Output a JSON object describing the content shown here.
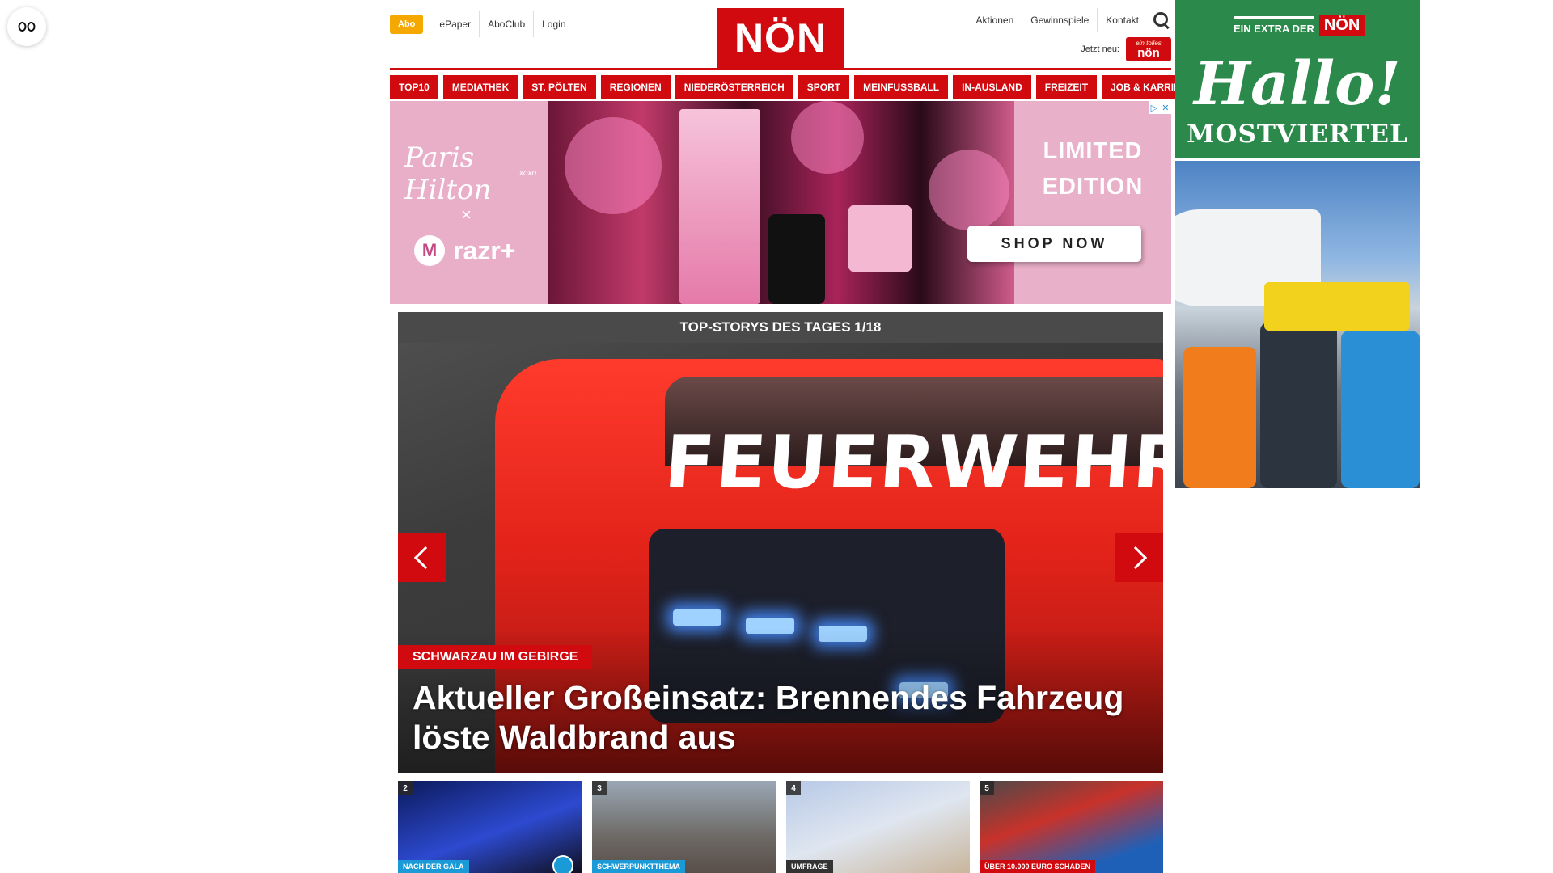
{
  "header": {
    "abo_label": "Abo",
    "util_left": [
      "ePaper",
      "AboClub",
      "Login"
    ],
    "logo_text": "NÖN",
    "util_right": [
      "Aktionen",
      "Gewinnspiele",
      "Kontakt"
    ],
    "jetzt_label": "Jetzt neu:",
    "heute_logo_small": "ein tolles",
    "heute_logo_text": "nön"
  },
  "nav": {
    "items": [
      "TOP10",
      "MEDIATHEK",
      "ST. PÖLTEN",
      "REGIONEN",
      "NIEDERÖSTERREICH",
      "SPORT",
      "MEINFUSSBALL",
      "IN-AUSLAND",
      "FREIZEIT",
      "JOB & KARRIERE"
    ]
  },
  "ad_banner": {
    "brand_script": "Paris Hilton",
    "brand_xxx": "xoxo",
    "times": "×",
    "razr_logo": "M",
    "razr_text": "razr+",
    "headline_line1": "LIMITED",
    "headline_line2": "EDITION",
    "cta": "SHOP NOW",
    "adchoices": [
      "▷",
      "✕"
    ]
  },
  "sky_ad": {
    "extra_label": "EIN EXTRA DER",
    "non_label": "NÖN",
    "hallo": "Hallo!",
    "region": "MOSTVIERTEL"
  },
  "stories": {
    "heading": "TOP-STORYS DES TAGES 1/18",
    "hero": {
      "truck_text": "FEUERWEHR",
      "kicker": "SCHWARZAU IM GEBIRGE",
      "title": "Aktueller Großeinsatz: Brennendes Fahrzeug löste Waldbrand aus"
    },
    "thumbs": [
      {
        "num": "2",
        "kicker": "NACH DER GALA"
      },
      {
        "num": "3",
        "kicker": "SCHWERPUNKTTHEMA"
      },
      {
        "num": "4",
        "kicker": "UMFRAGE"
      },
      {
        "num": "5",
        "kicker": "ÜBER 10.000 EURO SCHADEN"
      }
    ]
  },
  "colors": {
    "brand_red": "#d10a10",
    "abo_orange": "#f5a800",
    "sky_green": "#2b8a4b",
    "story_bar": "#4a4a4a"
  },
  "icons": {
    "reader": "reader-mode-icon",
    "search": "search-icon",
    "prev": "chevron-left-icon",
    "next": "chevron-right-icon"
  }
}
